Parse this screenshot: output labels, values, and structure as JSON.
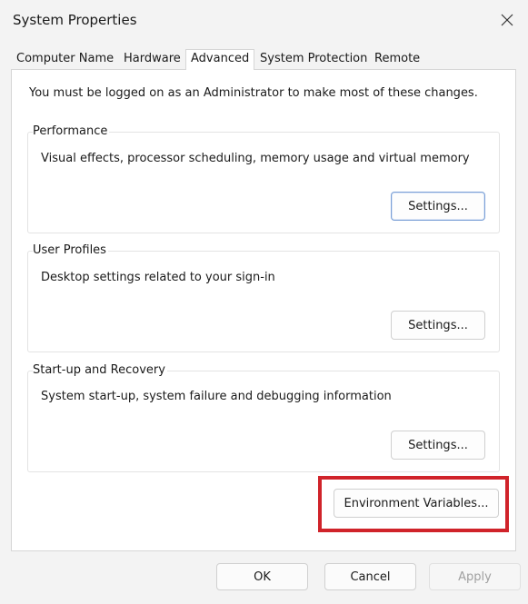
{
  "window": {
    "title": "System Properties"
  },
  "tabs": [
    {
      "label": "Computer Name",
      "active": false
    },
    {
      "label": "Hardware",
      "active": false
    },
    {
      "label": "Advanced",
      "active": true
    },
    {
      "label": "System Protection",
      "active": false
    },
    {
      "label": "Remote",
      "active": false
    }
  ],
  "notice": "You must be logged on as an Administrator to make most of these changes.",
  "performance": {
    "title": "Performance",
    "description": "Visual effects, processor scheduling, memory usage and virtual memory",
    "button_label": "Settings..."
  },
  "user_profiles": {
    "title": "User Profiles",
    "description": "Desktop settings related to your sign-in",
    "button_label": "Settings..."
  },
  "startup_recovery": {
    "title": "Start-up and Recovery",
    "description": "System start-up, system failure and debugging information",
    "button_label": "Settings..."
  },
  "environment_variables_label": "Environment Variables...",
  "footer": {
    "ok_label": "OK",
    "cancel_label": "Cancel",
    "apply_label": "Apply"
  },
  "colors": {
    "highlight": "#d0232a",
    "focus_border": "#7a9fd6",
    "disabled_text": "#a0a0a0"
  }
}
